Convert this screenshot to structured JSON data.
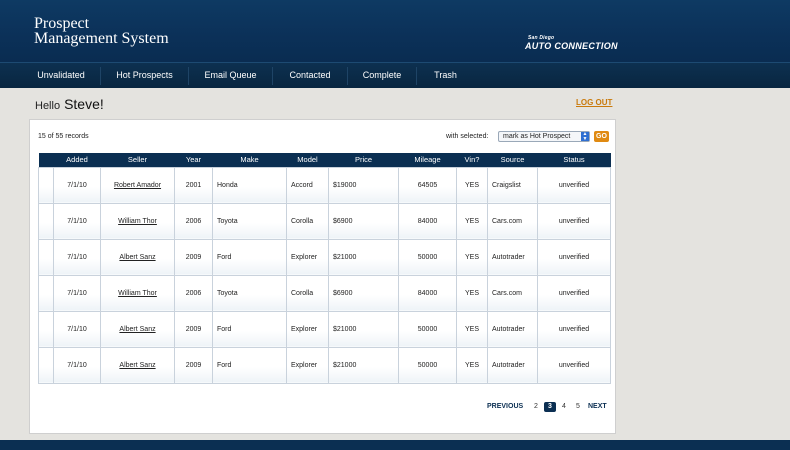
{
  "header": {
    "title_line1": "Prospect",
    "title_line2": "Management System",
    "brand_small": "San Diego",
    "brand_big": "AUTO CONNECTION"
  },
  "nav": {
    "items": [
      {
        "label": "Unvalidated"
      },
      {
        "label": "Hot Prospects"
      },
      {
        "label": "Email Queue"
      },
      {
        "label": "Contacted"
      },
      {
        "label": "Complete"
      },
      {
        "label": "Trash"
      }
    ]
  },
  "greeting": {
    "hello": "Hello",
    "name": "Steve!",
    "logout": "LOG OUT"
  },
  "toolbar": {
    "records": "15 of 55 records",
    "with_selected": "with selected:",
    "action_value": "mark as Hot Prospect",
    "go": "GO"
  },
  "table": {
    "headers": [
      "",
      "Added",
      "Seller",
      "Year",
      "Make",
      "Model",
      "Price",
      "Mileage",
      "Vin?",
      "Source",
      "Status"
    ],
    "rows": [
      {
        "added": "7/1/10",
        "seller": "Robert Amador",
        "year": "2001",
        "make": "Honda",
        "model": "Accord",
        "price": "$19000",
        "mileage": "64505",
        "vin": "YES",
        "source": "Craigslist",
        "status": "unverified"
      },
      {
        "added": "7/1/10",
        "seller": "William Thor",
        "year": "2006",
        "make": "Toyota",
        "model": "Corolla",
        "price": "$6900",
        "mileage": "84000",
        "vin": "YES",
        "source": "Cars.com",
        "status": "unverified"
      },
      {
        "added": "7/1/10",
        "seller": "Albert Sanz",
        "year": "2009",
        "make": "Ford",
        "model": "Explorer",
        "price": "$21000",
        "mileage": "50000",
        "vin": "YES",
        "source": "Autotrader",
        "status": "unverified"
      },
      {
        "added": "7/1/10",
        "seller": "William Thor",
        "year": "2006",
        "make": "Toyota",
        "model": "Corolla",
        "price": "$6900",
        "mileage": "84000",
        "vin": "YES",
        "source": "Cars.com",
        "status": "unverified"
      },
      {
        "added": "7/1/10",
        "seller": "Albert Sanz",
        "year": "2009",
        "make": "Ford",
        "model": "Explorer",
        "price": "$21000",
        "mileage": "50000",
        "vin": "YES",
        "source": "Autotrader",
        "status": "unverified"
      },
      {
        "added": "7/1/10",
        "seller": "Albert Sanz",
        "year": "2009",
        "make": "Ford",
        "model": "Explorer",
        "price": "$21000",
        "mileage": "50000",
        "vin": "YES",
        "source": "Autotrader",
        "status": "unverified"
      }
    ]
  },
  "pagination": {
    "previous": "PREVIOUS",
    "pages": [
      "2",
      "3",
      "4",
      "5"
    ],
    "current": "3",
    "next": "NEXT"
  },
  "colors": {
    "header_bg": "#0b3159",
    "accent_orange": "#e08a12",
    "page_bg": "#e4e3df"
  }
}
